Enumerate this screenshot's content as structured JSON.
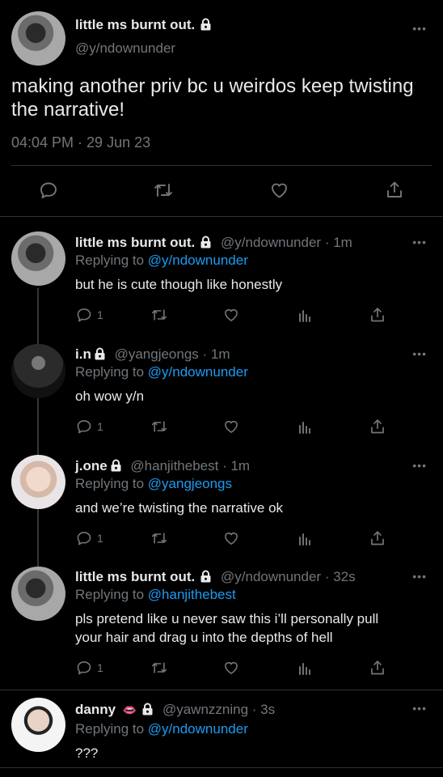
{
  "main_tweet": {
    "display_name": "little ms burnt out.",
    "handle": "@y/ndownunder",
    "text": "making another priv bc u weirdos keep twisting the narrative!",
    "timestamp": "04:04 PM · 29 Jun 23"
  },
  "replies": [
    {
      "display_name": "little ms burnt out.",
      "handle": "@y/ndownunder",
      "time": "· 1m",
      "replying_label": "Replying to",
      "replying_to": "@y/ndownunder",
      "text": "but he is cute though like honestly",
      "reply_count": "1"
    },
    {
      "display_name": "i.n",
      "handle": "@yangjeongs",
      "time": "· 1m",
      "replying_label": "Replying to",
      "replying_to": "@y/ndownunder",
      "text": "oh wow y/n",
      "reply_count": "1"
    },
    {
      "display_name": "j.one",
      "handle": "@hanjithebest",
      "time": "· 1m",
      "replying_label": "Replying to",
      "replying_to": "@yangjeongs",
      "text": "and we’re twisting the narrative ok",
      "reply_count": "1"
    },
    {
      "display_name": "little ms burnt out.",
      "handle": "@y/ndownunder",
      "time": "· 32s",
      "replying_label": "Replying to",
      "replying_to": "@hanjithebest",
      "text_line1": "pls pretend like u never saw this i’ll personally pull",
      "text_line2": "your hair and drag u into the depths of hell",
      "reply_count": "1"
    },
    {
      "display_name": "danny",
      "emoji": "👄",
      "handle": "@yawnzzning",
      "time": "· 3s",
      "replying_label": "Replying to",
      "replying_to": "@y/ndownunder",
      "text": "???"
    }
  ],
  "more_label": "•••",
  "colors": {
    "background": "#000000",
    "link": "#1d9bf0",
    "muted": "#71767b",
    "text": "#e7e9ea"
  }
}
